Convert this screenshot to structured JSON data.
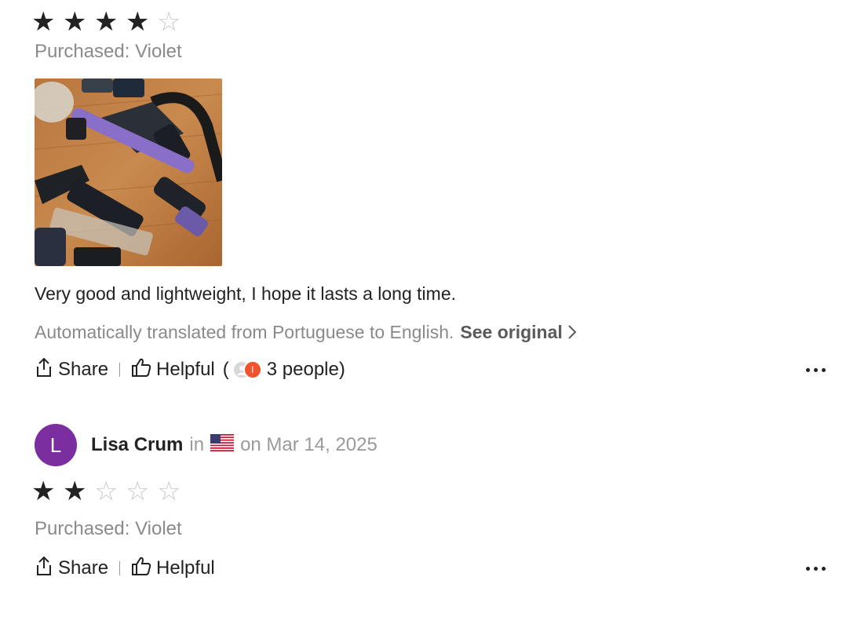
{
  "review1": {
    "rating": 4,
    "max_rating": 5,
    "purchased": "Purchased: Violet",
    "text": "Very good and lightweight, I hope it lasts a long time.",
    "translation_note": "Automatically translated from Portuguese to English.",
    "see_original": "See original",
    "share_label": "Share",
    "helpful_label": "Helpful",
    "helpful_open": "(",
    "helpful_count": "3 people",
    "helpful_close": ")",
    "mini_avatar_initial": "I"
  },
  "review2": {
    "avatar_initial": "L",
    "name": "Lisa Crum",
    "in_label": "in",
    "date": "on Mar 14, 2025",
    "rating": 2,
    "max_rating": 5,
    "purchased": "Purchased: Violet",
    "share_label": "Share",
    "helpful_label": "Helpful"
  },
  "colors": {
    "avatar": "#7b2ea0",
    "mini_avatar": "#f0542d",
    "muted_text": "#8a8a8a",
    "star_filled": "#222222",
    "star_empty": "#c9c9c9"
  },
  "icons": {
    "share": "share-icon",
    "helpful": "thumbs-up-icon",
    "more": "more-icon",
    "flag": "us-flag-icon",
    "chevron": "chevron-right-icon"
  }
}
